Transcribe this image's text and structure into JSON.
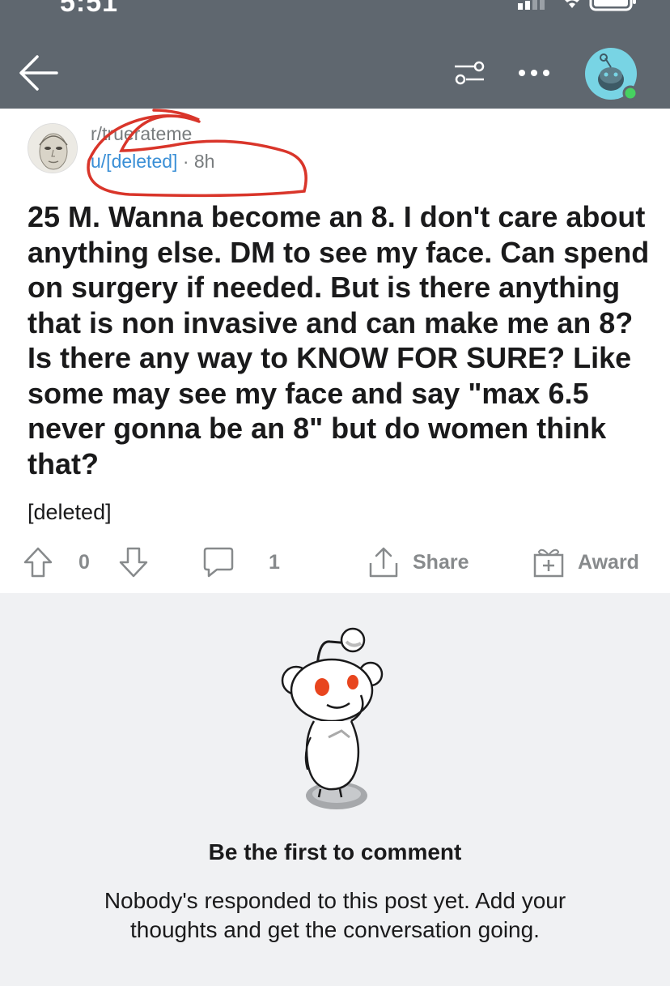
{
  "status_bar": {
    "time": "5:51"
  },
  "post": {
    "subreddit": "r/truerateme",
    "author": "u/[deleted]",
    "separator": "·",
    "age": "8h",
    "title": "25 M. Wanna become an 8. I don't care about anything else. DM to see my face. Can spend on surgery if needed. But is there anything that is non invasive and can make me an 8? Is there any way to KNOW FOR SURE? Like some may see my face and say \"max 6.5 never gonna be an 8\" but do women think that?",
    "body": "[deleted]"
  },
  "actions": {
    "vote_count": "0",
    "comment_count": "1",
    "share_label": "Share",
    "award_label": "Award"
  },
  "comments_empty": {
    "title": "Be the first to comment",
    "message": "Nobody's responded to this post yet. Add your thoughts and get the conversation going."
  },
  "icons": {
    "back": "back-arrow-icon",
    "filter": "sort-filter-icon",
    "more": "more-dots-icon",
    "avatar": "user-avatar-icon",
    "upvote": "upvote-arrow-icon",
    "downvote": "downvote-arrow-icon",
    "comment": "comment-bubble-icon",
    "share": "share-icon",
    "award": "award-gift-icon"
  },
  "colors": {
    "header_bg": "#5f676f",
    "link": "#3a8fd6",
    "muted": "#878a8c",
    "annotation": "#d9352a",
    "empty_bg": "#f0f1f3",
    "avatar_bg": "#78d4e4",
    "online": "#46d160"
  }
}
